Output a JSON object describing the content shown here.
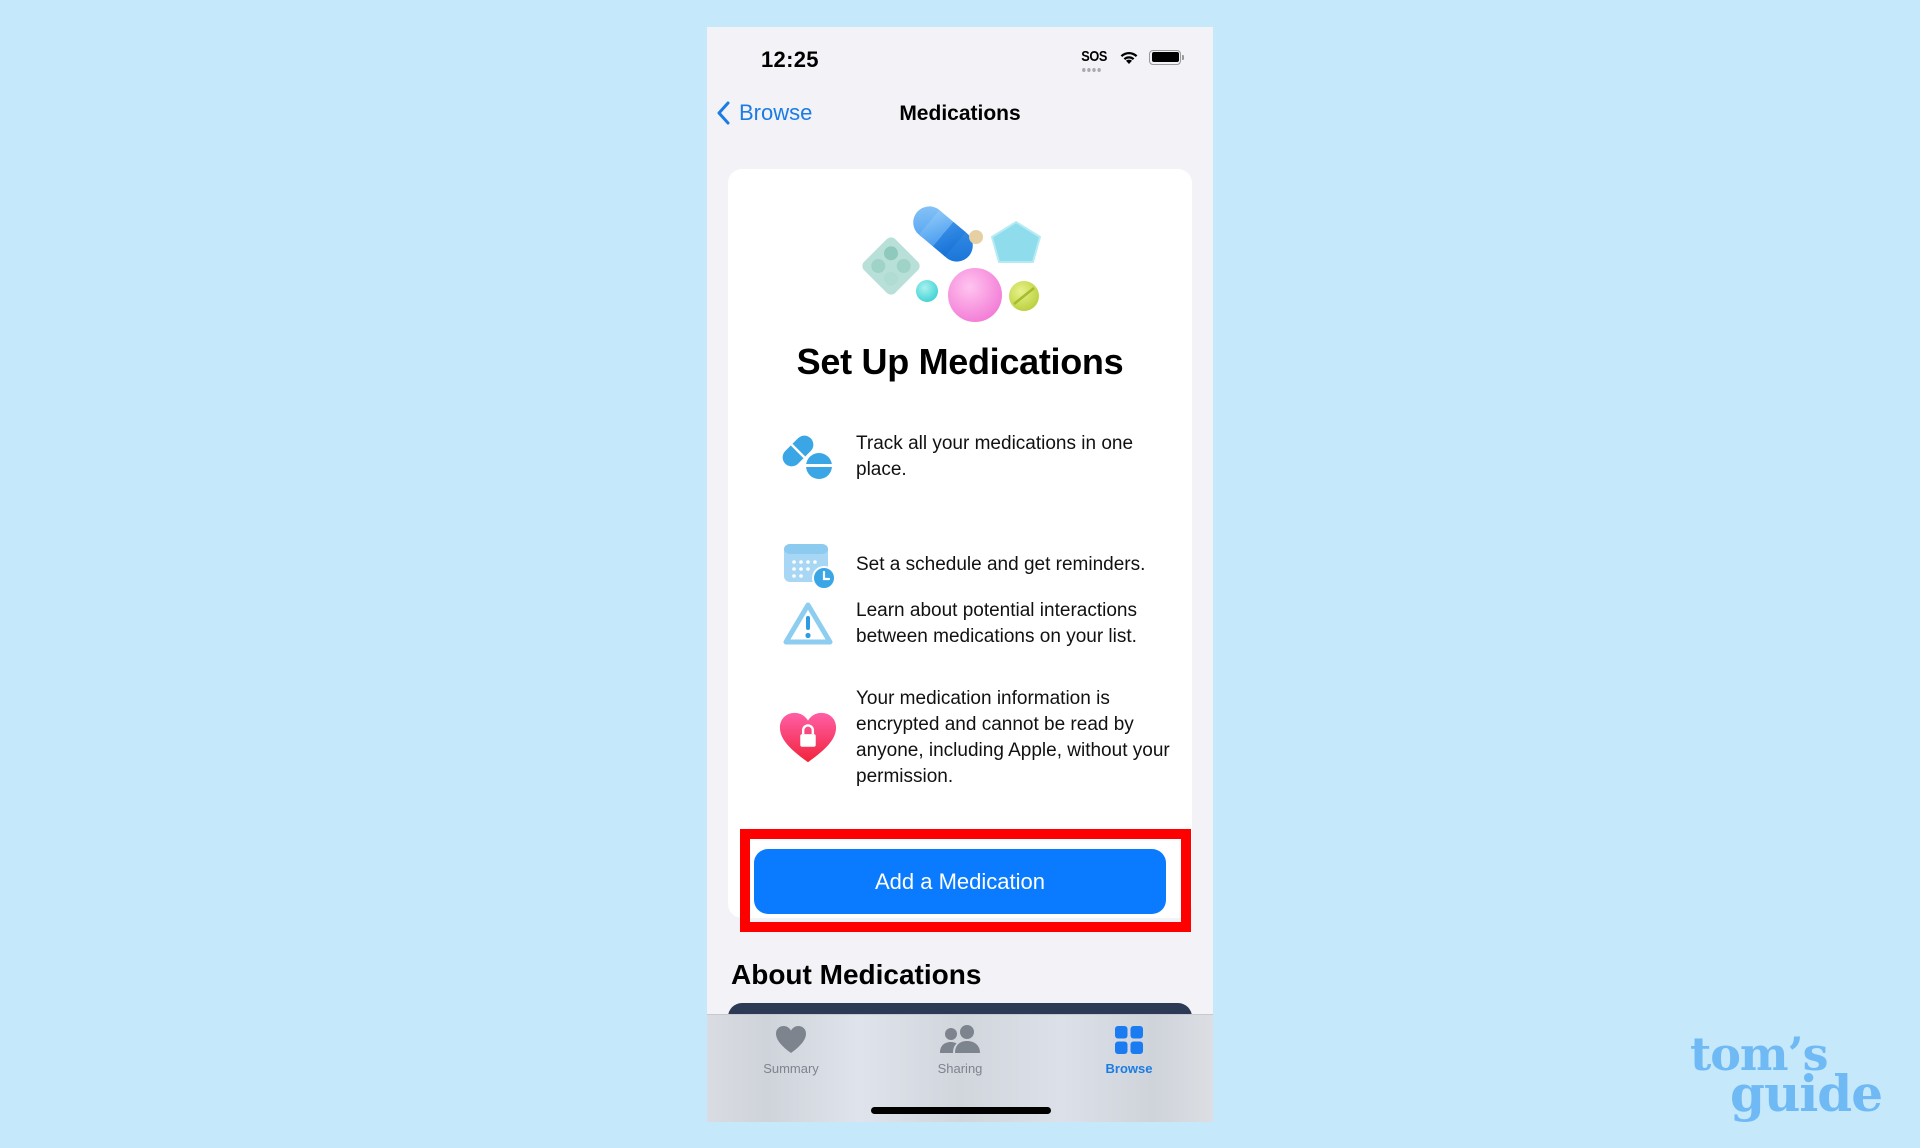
{
  "status_bar": {
    "time": "12:25",
    "carrier_status": "SOS",
    "icons": [
      "wifi-icon",
      "battery-icon"
    ]
  },
  "nav": {
    "back_label": "Browse",
    "back_icon": "chevron-left-icon",
    "title": "Medications"
  },
  "setup_card": {
    "hero_icon": "pills-illustration",
    "title": "Set Up Medications",
    "features": [
      {
        "icon": "pills-icon",
        "text": "Track all your medications in one place."
      },
      {
        "icon": "calendar-clock-icon",
        "text": "Set a schedule and get reminders."
      },
      {
        "icon": "warning-triangle-icon",
        "text": "Learn about potential interactions between medications on your list."
      },
      {
        "icon": "heart-lock-icon",
        "text": "Your medication information is encrypted and cannot be read by anyone, including Apple, without your permission."
      }
    ],
    "primary_button": "Add a Medication"
  },
  "about_section": {
    "title": "About Medications"
  },
  "tab_bar": {
    "tabs": [
      {
        "label": "Summary",
        "icon": "heart-icon",
        "active": false
      },
      {
        "label": "Sharing",
        "icon": "people-icon",
        "active": false
      },
      {
        "label": "Browse",
        "icon": "grid-icon",
        "active": true
      }
    ]
  },
  "colors": {
    "accent": "#0a7bff",
    "link": "#1b7ce4",
    "highlight": "#ff0000",
    "background": "#c5e8fb"
  },
  "watermark": {
    "line1": "tom’s",
    "line2": "guide"
  }
}
